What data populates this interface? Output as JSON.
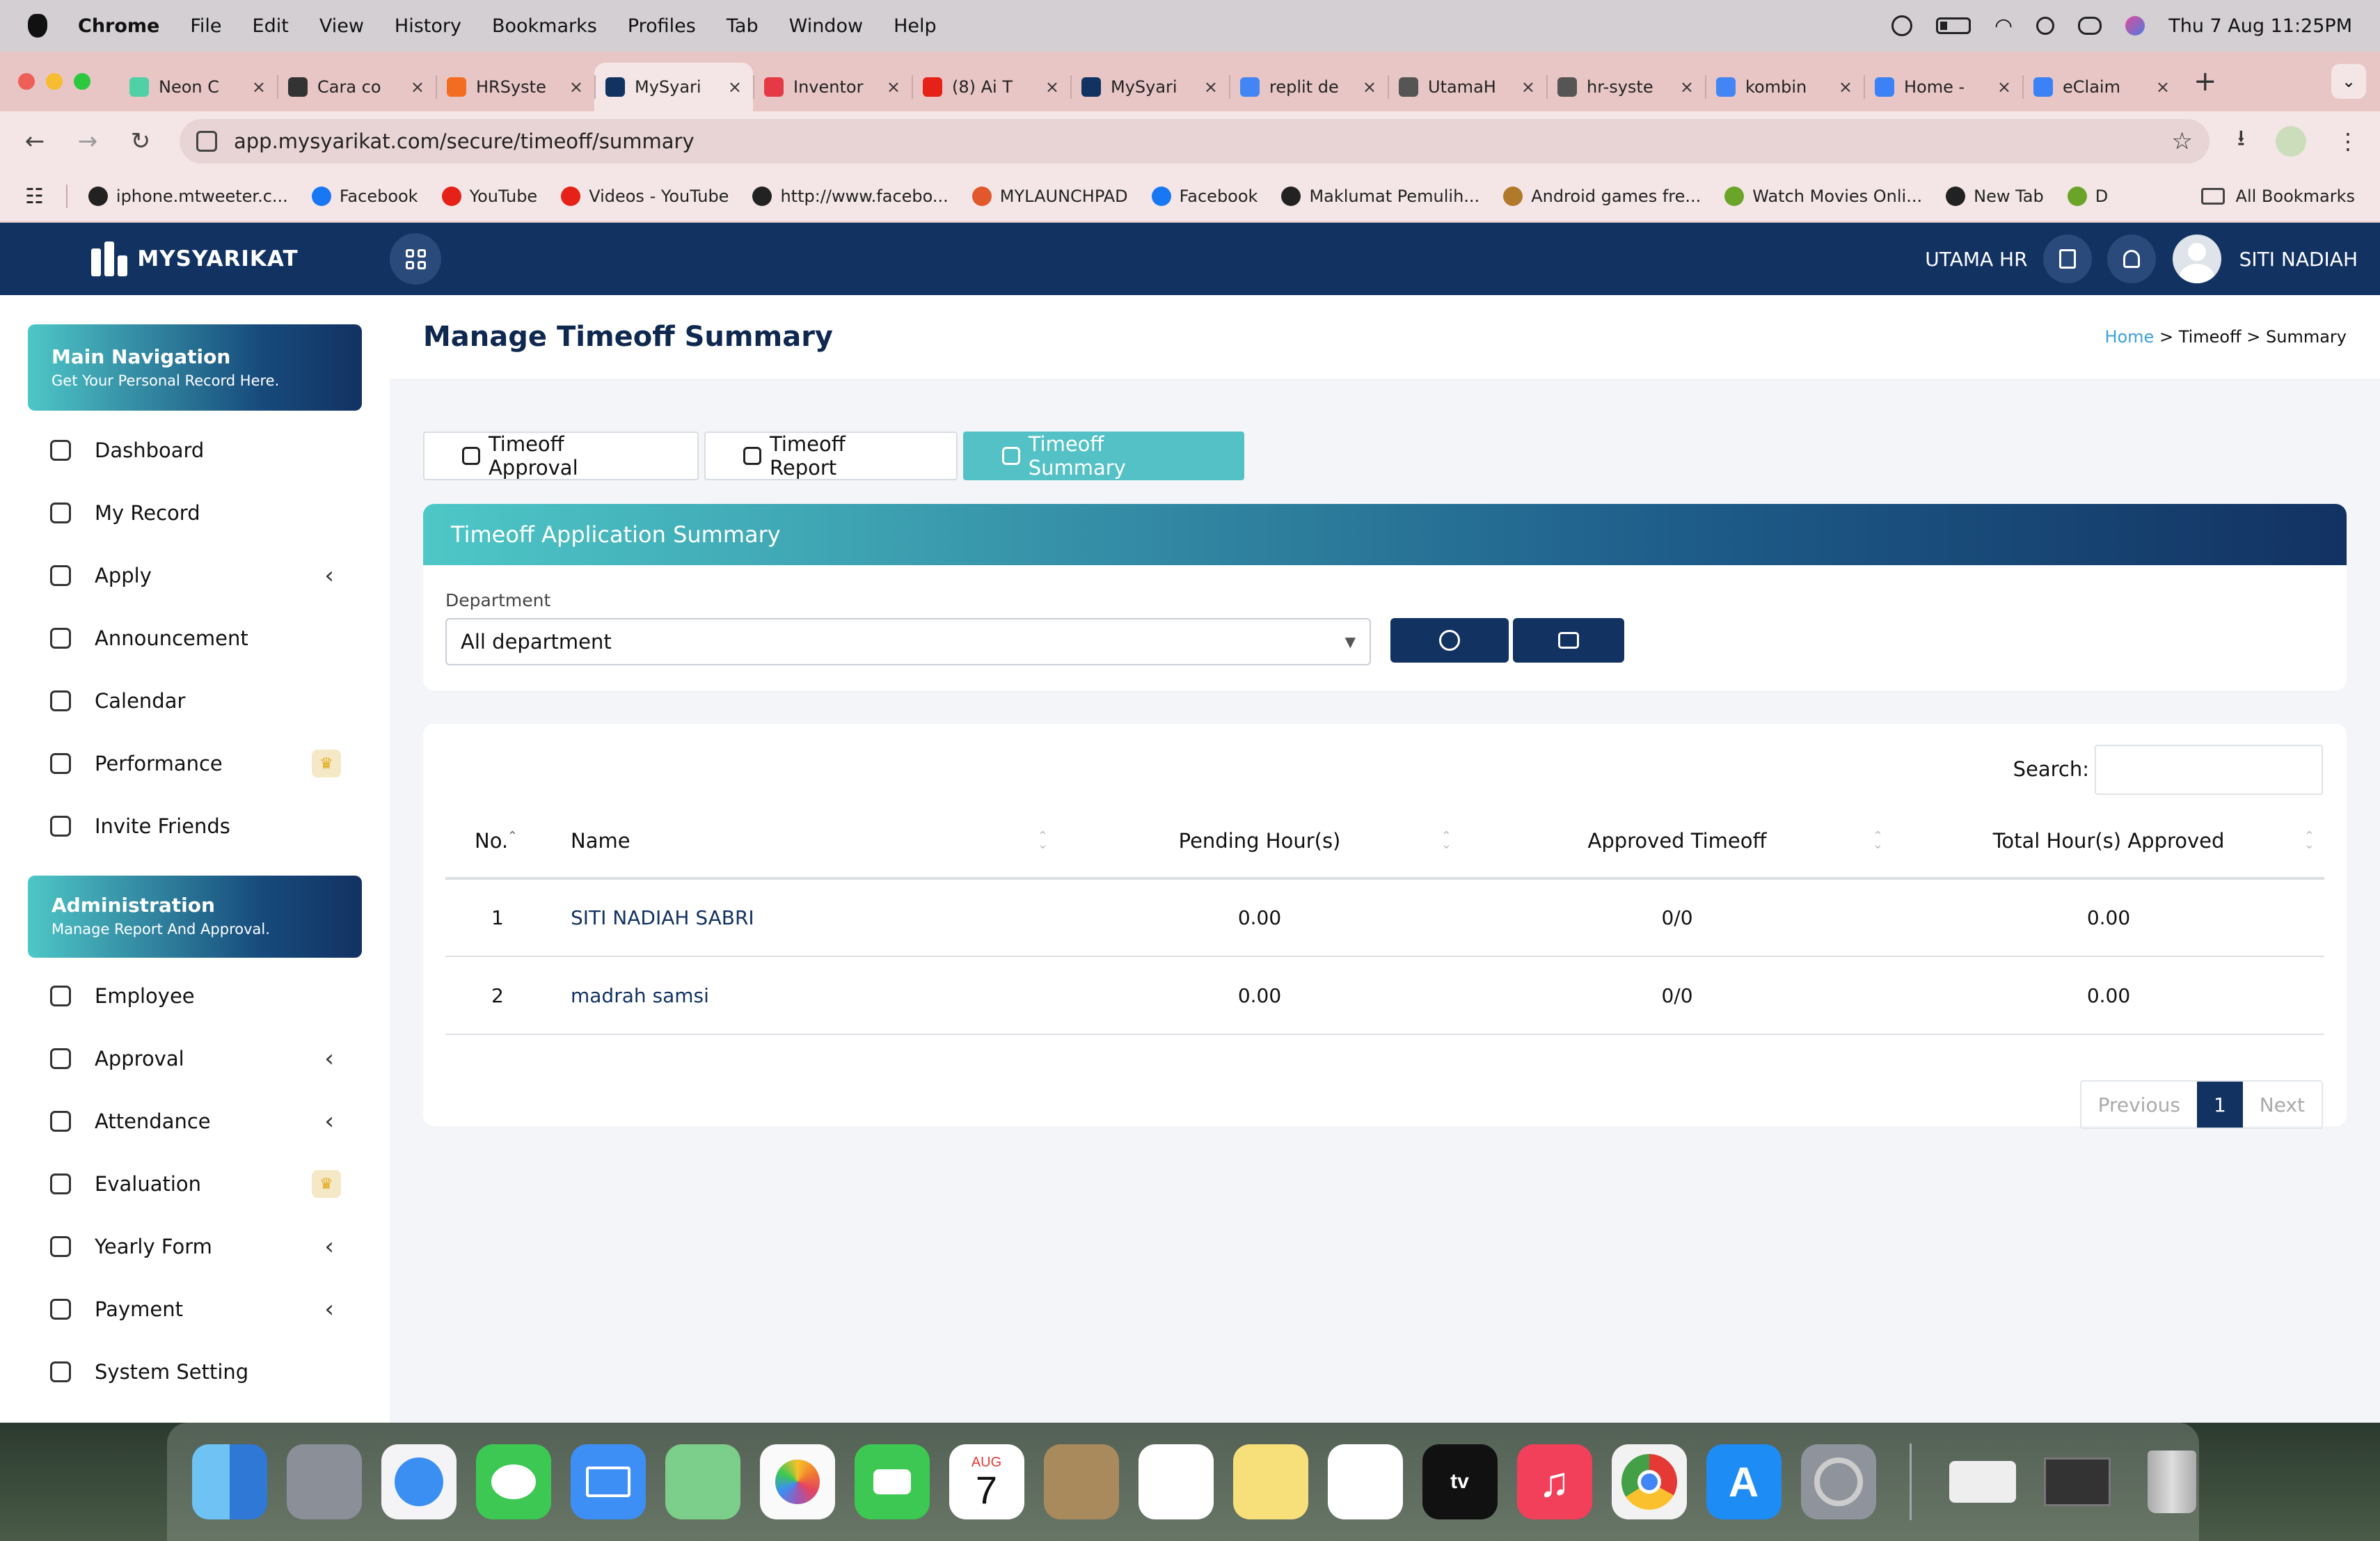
{
  "menubar": {
    "app": "Chrome",
    "items": [
      "File",
      "Edit",
      "View",
      "History",
      "Bookmarks",
      "Profiles",
      "Tab",
      "Window",
      "Help"
    ],
    "clock": "Thu 7 Aug  11:25PM"
  },
  "tabs": [
    {
      "title": "Neon C",
      "color": "#4fd1a5"
    },
    {
      "title": "Cara co",
      "color": "#333333"
    },
    {
      "title": "HRSyste",
      "color": "#f26d21"
    },
    {
      "title": "MySyari",
      "color": "#123262",
      "active": true
    },
    {
      "title": "Inventor",
      "color": "#e63946"
    },
    {
      "title": "(8) Ai T",
      "color": "#e62117"
    },
    {
      "title": "MySyari",
      "color": "#123262"
    },
    {
      "title": "replit de",
      "color": "#4285f4"
    },
    {
      "title": "UtamaH",
      "color": "#555555"
    },
    {
      "title": "hr-syste",
      "color": "#555555"
    },
    {
      "title": "kombin",
      "color": "#4285f4"
    },
    {
      "title": "Home -",
      "color": "#3b82f6"
    },
    {
      "title": "eClaim",
      "color": "#3b82f6"
    }
  ],
  "toolbar": {
    "url": "app.mysyarikat.com/secure/timeoff/summary"
  },
  "bookmarks": [
    {
      "label": "iphone.mtweeter.c...",
      "color": "#222222"
    },
    {
      "label": "Facebook",
      "color": "#1877f2"
    },
    {
      "label": "YouTube",
      "color": "#e62117"
    },
    {
      "label": "Videos - YouTube",
      "color": "#e62117"
    },
    {
      "label": "http://www.facebo...",
      "color": "#222222"
    },
    {
      "label": "MYLAUNCHPAD",
      "color": "#e2572b"
    },
    {
      "label": "Facebook",
      "color": "#1877f2"
    },
    {
      "label": "Maklumat Pemulih...",
      "color": "#222222"
    },
    {
      "label": "Android games fre...",
      "color": "#b07a2a"
    },
    {
      "label": "Watch Movies Onli...",
      "color": "#6aa52a"
    },
    {
      "label": "New Tab",
      "color": "#222222"
    },
    {
      "label": "D",
      "color": "#6aa52a"
    }
  ],
  "bookmarks_all": "All Bookmarks",
  "app": {
    "brand": "MYSYARIKAT",
    "company": "UTAMA HR",
    "user": "SITI NADIAH"
  },
  "sidebar": {
    "main_title": "Main Navigation",
    "main_sub": "Get Your Personal Record Here.",
    "main_items": [
      {
        "label": "Dashboard",
        "icon": "dashboard-icon",
        "chevron": false,
        "crown": false
      },
      {
        "label": "My Record",
        "icon": "folder-icon",
        "chevron": false,
        "crown": false
      },
      {
        "label": "Apply",
        "icon": "apply-icon",
        "chevron": true,
        "crown": false
      },
      {
        "label": "Announcement",
        "icon": "announcement-icon",
        "chevron": false,
        "crown": false
      },
      {
        "label": "Calendar",
        "icon": "calendar-icon",
        "chevron": false,
        "crown": false
      },
      {
        "label": "Performance",
        "icon": "performance-icon",
        "chevron": false,
        "crown": true
      },
      {
        "label": "Invite Friends",
        "icon": "gift-icon",
        "chevron": false,
        "crown": false
      }
    ],
    "admin_title": "Administration",
    "admin_sub": "Manage Report And Approval.",
    "admin_items": [
      {
        "label": "Employee",
        "icon": "employee-icon",
        "chevron": false,
        "crown": false
      },
      {
        "label": "Approval",
        "icon": "approval-icon",
        "chevron": true,
        "crown": false
      },
      {
        "label": "Attendance",
        "icon": "clock-icon",
        "chevron": true,
        "crown": false
      },
      {
        "label": "Evaluation",
        "icon": "evaluation-icon",
        "chevron": false,
        "crown": true
      },
      {
        "label": "Yearly Form",
        "icon": "form-icon",
        "chevron": true,
        "crown": false
      },
      {
        "label": "Payment",
        "icon": "payment-icon",
        "chevron": true,
        "crown": false
      },
      {
        "label": "System Setting",
        "icon": "gear-icon",
        "chevron": false,
        "crown": false
      }
    ]
  },
  "page": {
    "title": "Manage Timeoff Summary",
    "breadcrumb": {
      "home": "Home",
      "sep": " > ",
      "mid": "Timeoff",
      "last": "Summary"
    },
    "tabs": [
      {
        "label": "Timeoff Approval",
        "active": false
      },
      {
        "label": "Timeoff Report",
        "active": false
      },
      {
        "label": "Timeoff Summary",
        "active": true
      }
    ],
    "card_title": "Timeoff Application Summary",
    "department_label": "Department",
    "department_value": "All department",
    "search_label": "Search:",
    "columns": [
      "No.",
      "Name",
      "Pending Hour(s)",
      "Approved Timeoff",
      "Total Hour(s) Approved"
    ],
    "rows": [
      {
        "no": "1",
        "name": "SITI NADIAH SABRI",
        "pending": "0.00",
        "approved": "0/0",
        "total": "0.00"
      },
      {
        "no": "2",
        "name": "madrah samsi",
        "pending": "0.00",
        "approved": "0/0",
        "total": "0.00"
      }
    ],
    "pager": {
      "prev": "Previous",
      "current": "1",
      "next": "Next"
    }
  },
  "dock": {
    "calendar_month": "AUG",
    "calendar_day": "7",
    "tv_label": "tv"
  },
  "colors": {
    "navy": "#123262",
    "teal": "#53c1c5",
    "link": "#3aa0d8"
  }
}
